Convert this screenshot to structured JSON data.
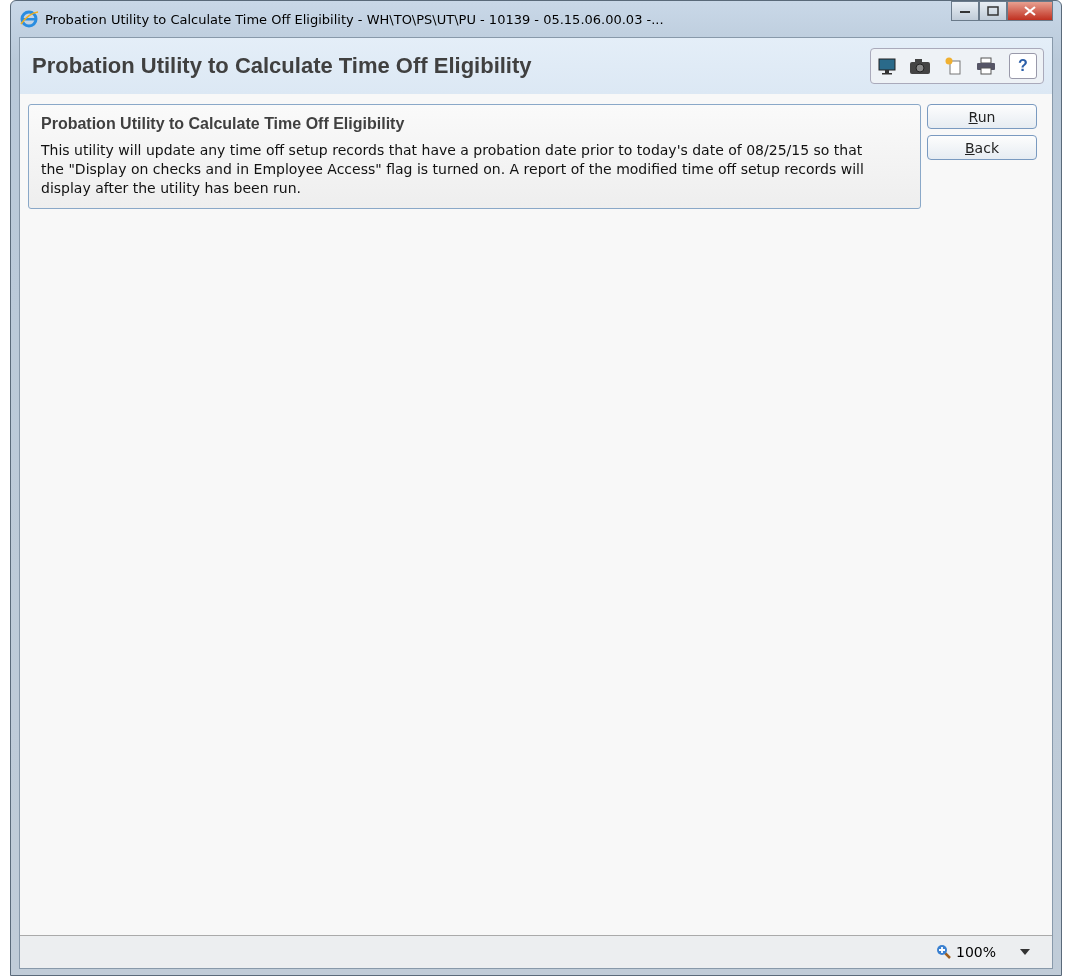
{
  "window": {
    "title": "Probation Utility to Calculate Time Off Eligibility - WH\\TO\\PS\\UT\\PU - 10139 - 05.15.06.00.03 -..."
  },
  "header": {
    "title": "Probation Utility to Calculate Time Off Eligibility",
    "help": "?"
  },
  "panel": {
    "title": "Probation Utility to Calculate Time Off Eligibility",
    "text": "This utility will update any time off setup records that have a probation date prior to today's date of 08/25/15 so that the \"Display on checks and in Employee Access\" flag is turned on. A report of the modified time off setup records will display after the utility has been run."
  },
  "buttons": [
    "Run",
    "Back"
  ],
  "status_bar": {
    "zoom": "100%"
  }
}
